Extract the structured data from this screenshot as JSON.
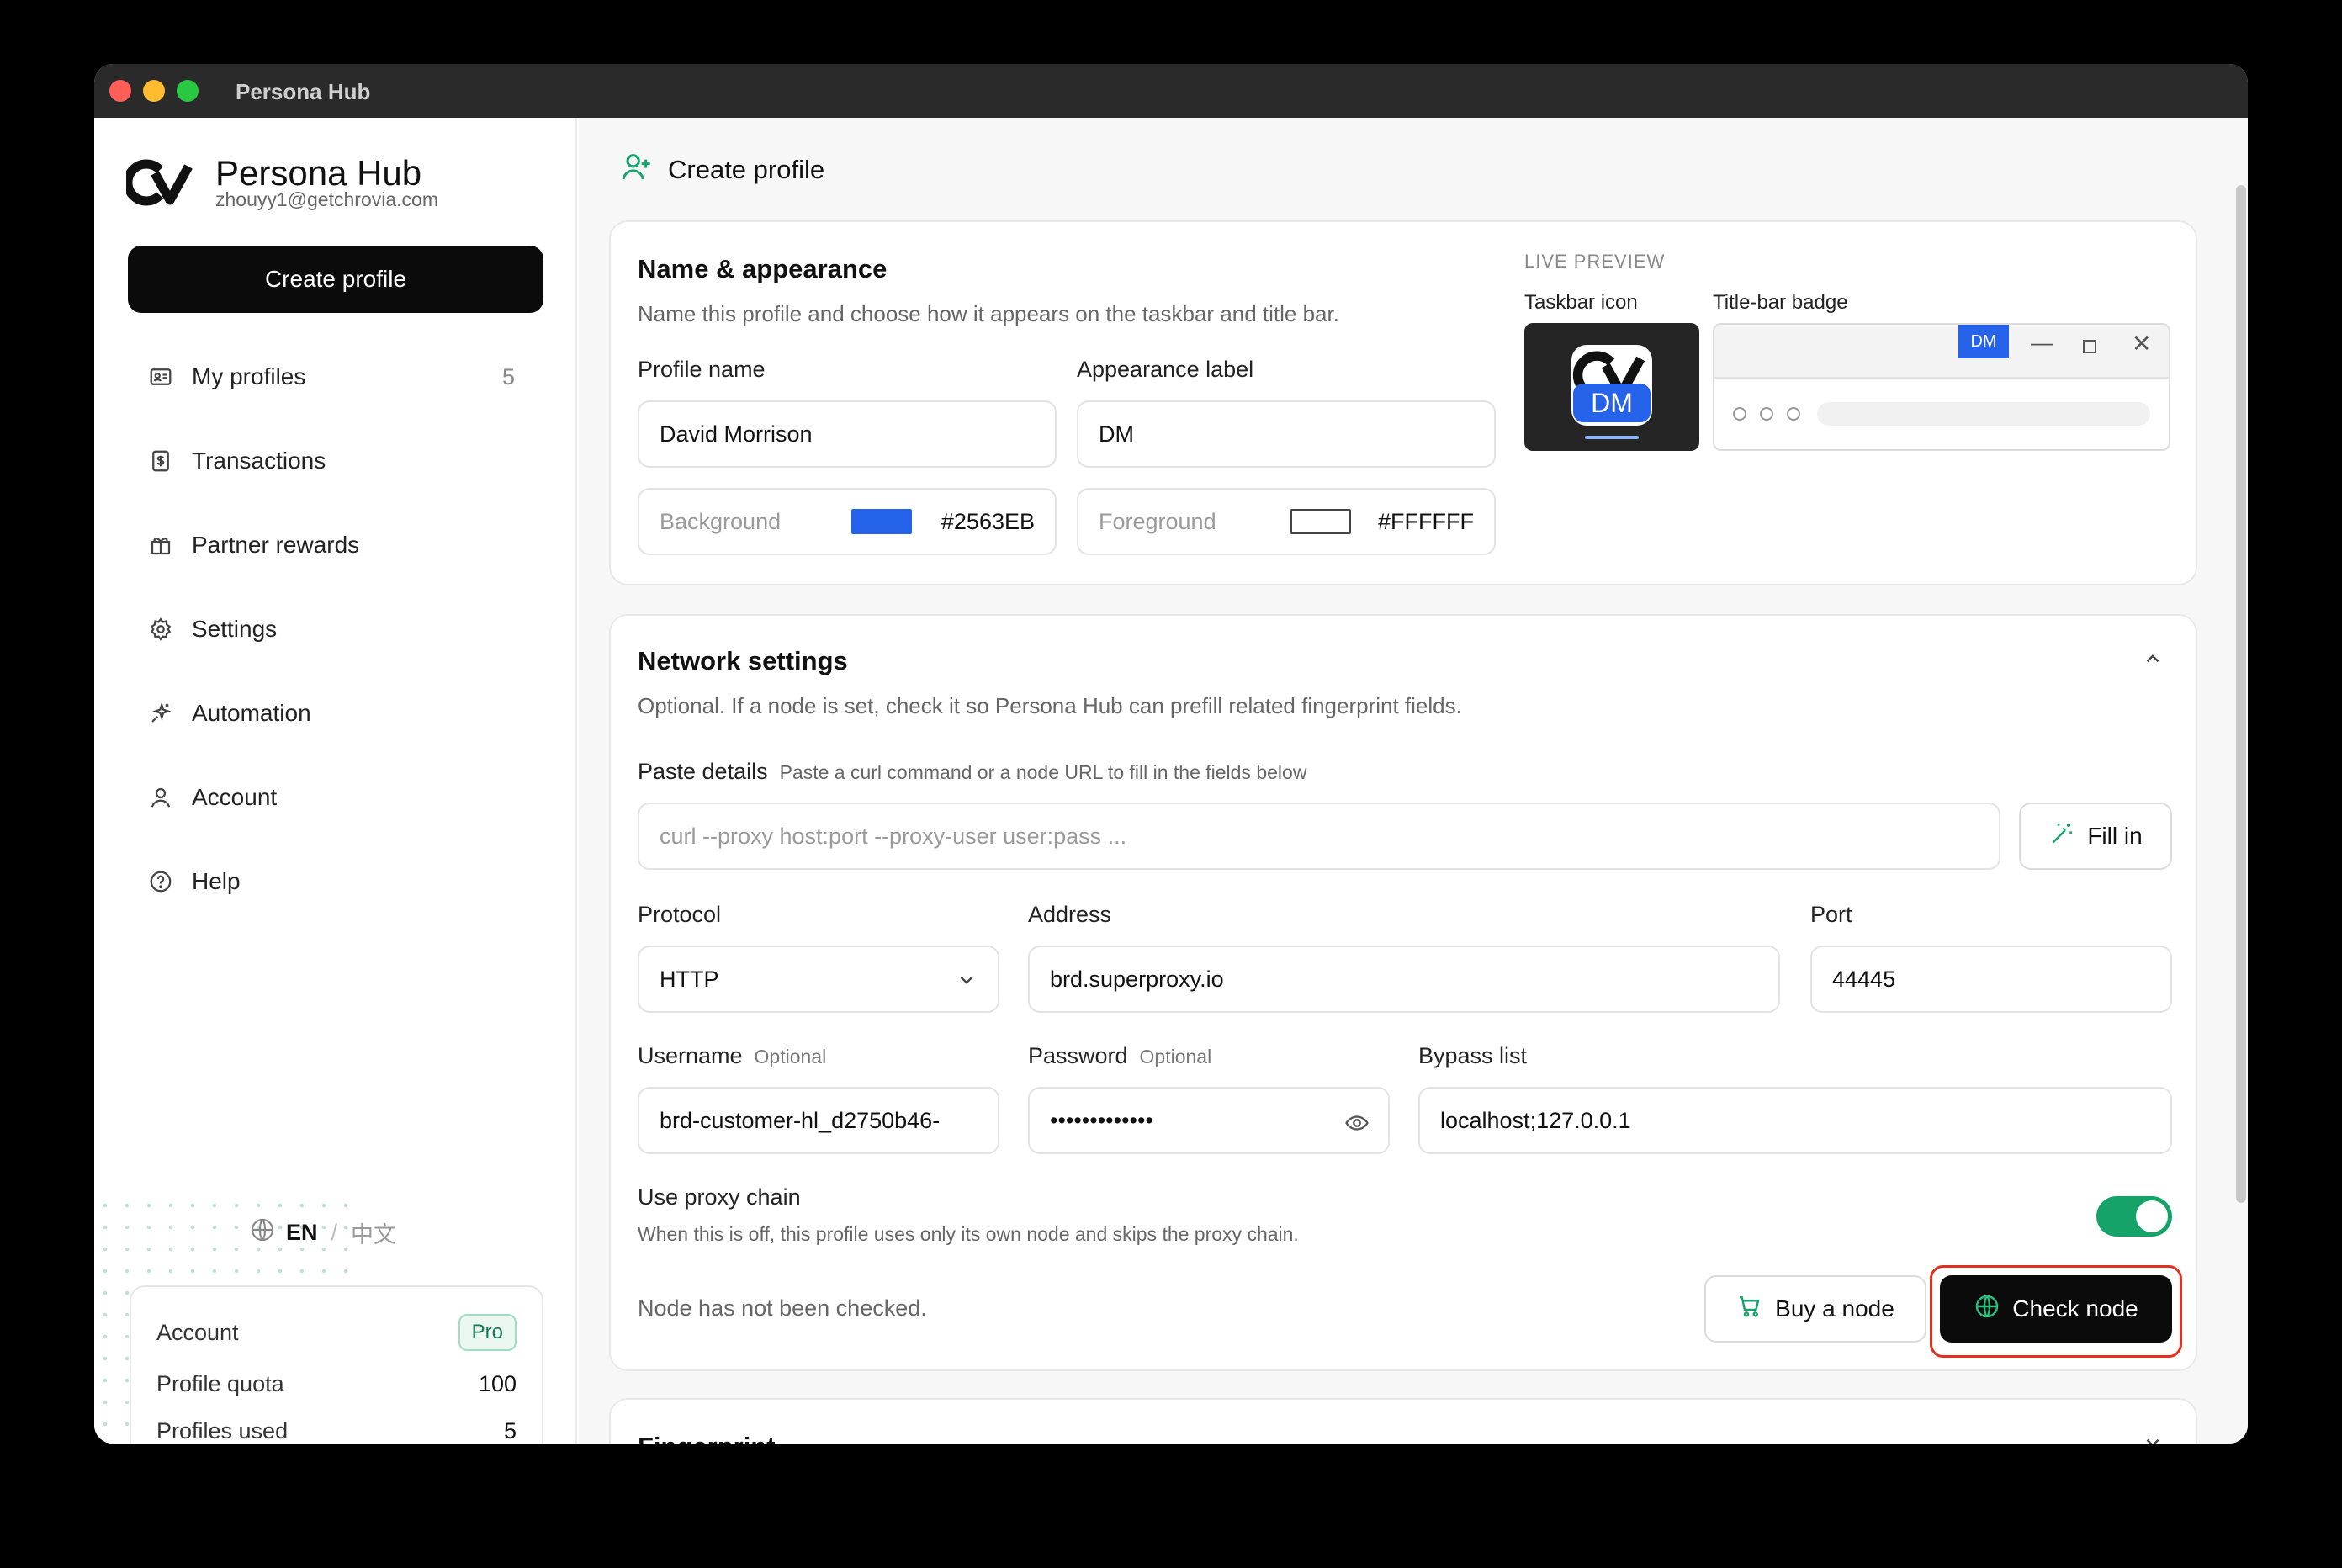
{
  "window": {
    "title": "Persona Hub"
  },
  "sidebar": {
    "brand": "Persona Hub",
    "email": "zhouyy1@getchrovia.com",
    "create_label": "Create profile",
    "items": [
      {
        "label": "My profiles",
        "icon": "id-card-icon",
        "count": "5"
      },
      {
        "label": "Transactions",
        "icon": "receipt-icon"
      },
      {
        "label": "Partner rewards",
        "icon": "gift-icon"
      },
      {
        "label": "Settings",
        "icon": "gear-icon"
      },
      {
        "label": "Automation",
        "icon": "sparkle-icon"
      },
      {
        "label": "Account",
        "icon": "user-icon"
      },
      {
        "label": "Help",
        "icon": "help-circle-icon"
      }
    ],
    "lang": {
      "en": "EN",
      "sep": "/",
      "zh": "中文"
    },
    "account_card": {
      "account_label": "Account",
      "plan": "Pro",
      "quota_label": "Profile quota",
      "quota_value": "100",
      "used_label": "Profiles used",
      "used_value": "5"
    }
  },
  "page": {
    "title": "Create profile"
  },
  "appearance": {
    "title": "Name & appearance",
    "subtitle": "Name this profile and choose how it appears on the taskbar and title bar.",
    "profile_name_label": "Profile name",
    "profile_name_value": "David Morrison",
    "appearance_label_label": "Appearance label",
    "appearance_label_value": "DM",
    "background_label": "Background",
    "background_hex": "#2563EB",
    "foreground_label": "Foreground",
    "foreground_hex": "#FFFFFF",
    "preview": {
      "caption": "LIVE PREVIEW",
      "taskbar_label": "Taskbar icon",
      "titlebar_label": "Title-bar badge",
      "badge_text": "DM"
    }
  },
  "network": {
    "title": "Network settings",
    "subtitle": "Optional. If a node is set, check it so Persona Hub can prefill related fingerprint fields.",
    "paste_label": "Paste details",
    "paste_hint": "Paste a curl command or a node URL to fill in the fields below",
    "paste_placeholder": "curl --proxy host:port --proxy-user user:pass ...",
    "fill_label": "Fill in",
    "protocol_label": "Protocol",
    "protocol_value": "HTTP",
    "address_label": "Address",
    "address_value": "brd.superproxy.io",
    "port_label": "Port",
    "port_value": "44445",
    "username_label": "Username",
    "optional": "Optional",
    "username_value": "brd-customer-hl_d2750b46-",
    "password_label": "Password",
    "password_value": "•••••••••••••",
    "bypass_label": "Bypass list",
    "bypass_value": "localhost;127.0.0.1",
    "chain_label": "Use proxy chain",
    "chain_hint": "When this is off, this profile uses only its own node and skips the proxy chain.",
    "chain_on": true,
    "status": "Node has not been checked.",
    "buy_label": "Buy a node",
    "check_label": "Check node"
  },
  "fingerprint": {
    "title": "Fingerprint"
  },
  "colors": {
    "accent": "#16a36a",
    "badge_bg": "#2563EB",
    "highlight": "#e0301e"
  }
}
